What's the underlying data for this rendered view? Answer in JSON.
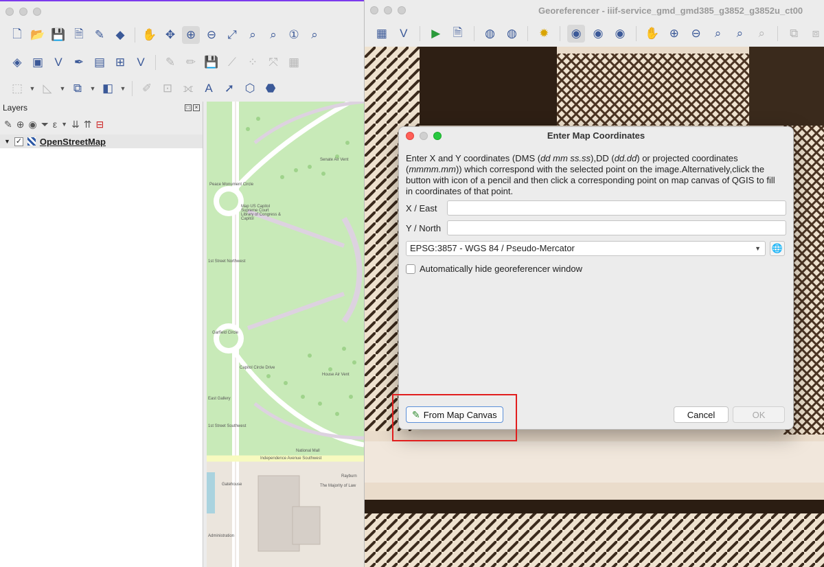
{
  "qgis": {
    "layers_panel_title": "Layers",
    "layer_name": "OpenStreetMap",
    "map_labels": {
      "senate_air_vent": "Senate Air Vent",
      "peace_monument_circle": "Peace Monument Circle",
      "library": "Map US Capitol Supreme Court Library of Congress & Capitol",
      "first_street_northwest": "1st Street Northwest",
      "garfield_circle": "Garfield Circle",
      "capitol_circle_drive": "Capitol Circle Drive",
      "house_air_vent": "House Air Vent",
      "first_street_southwest": "1st Street Southwest",
      "national_mall": "National Mall",
      "independence_avenue": "Independence Avenue Southwest",
      "rayburn": "Rayburn",
      "gatehouse": "Gatehouse",
      "majority_of_law": "The Majority of Law",
      "administration": "Administration",
      "east_gallery": "East Gallery"
    }
  },
  "georeferencer": {
    "window_title": "Georeferencer - iiif-service_gmd_gmd385_g3852_g3852u_ct00"
  },
  "dialog": {
    "title": "Enter Map Coordinates",
    "desc_1": "Enter X and Y coordinates (DMS (",
    "desc_em1": "dd mm ss.ss",
    "desc_2": "),DD (",
    "desc_em2": "dd.dd",
    "desc_3": ") or projected coordinates (",
    "desc_em3": "mmmm.mm",
    "desc_4": ")) which correspond with the selected point on the image.Alternatively,click the button with icon of a pencil and then click a corresponding point on map canvas of QGIS to fill in coordinates of that point.",
    "x_label": "X / East",
    "x_value": "",
    "y_label": "Y / North",
    "y_value": "",
    "crs": "EPSG:3857 - WGS 84 / Pseudo-Mercator",
    "auto_hide_label": "Automatically hide georeferencer window",
    "auto_hide_checked": false,
    "from_canvas_label": "From Map Canvas",
    "cancel_label": "Cancel",
    "ok_label": "OK"
  },
  "colors": {
    "highlight": "#e11d1d",
    "accent": "#5b8fd8",
    "map_green": "#c8eab8"
  }
}
